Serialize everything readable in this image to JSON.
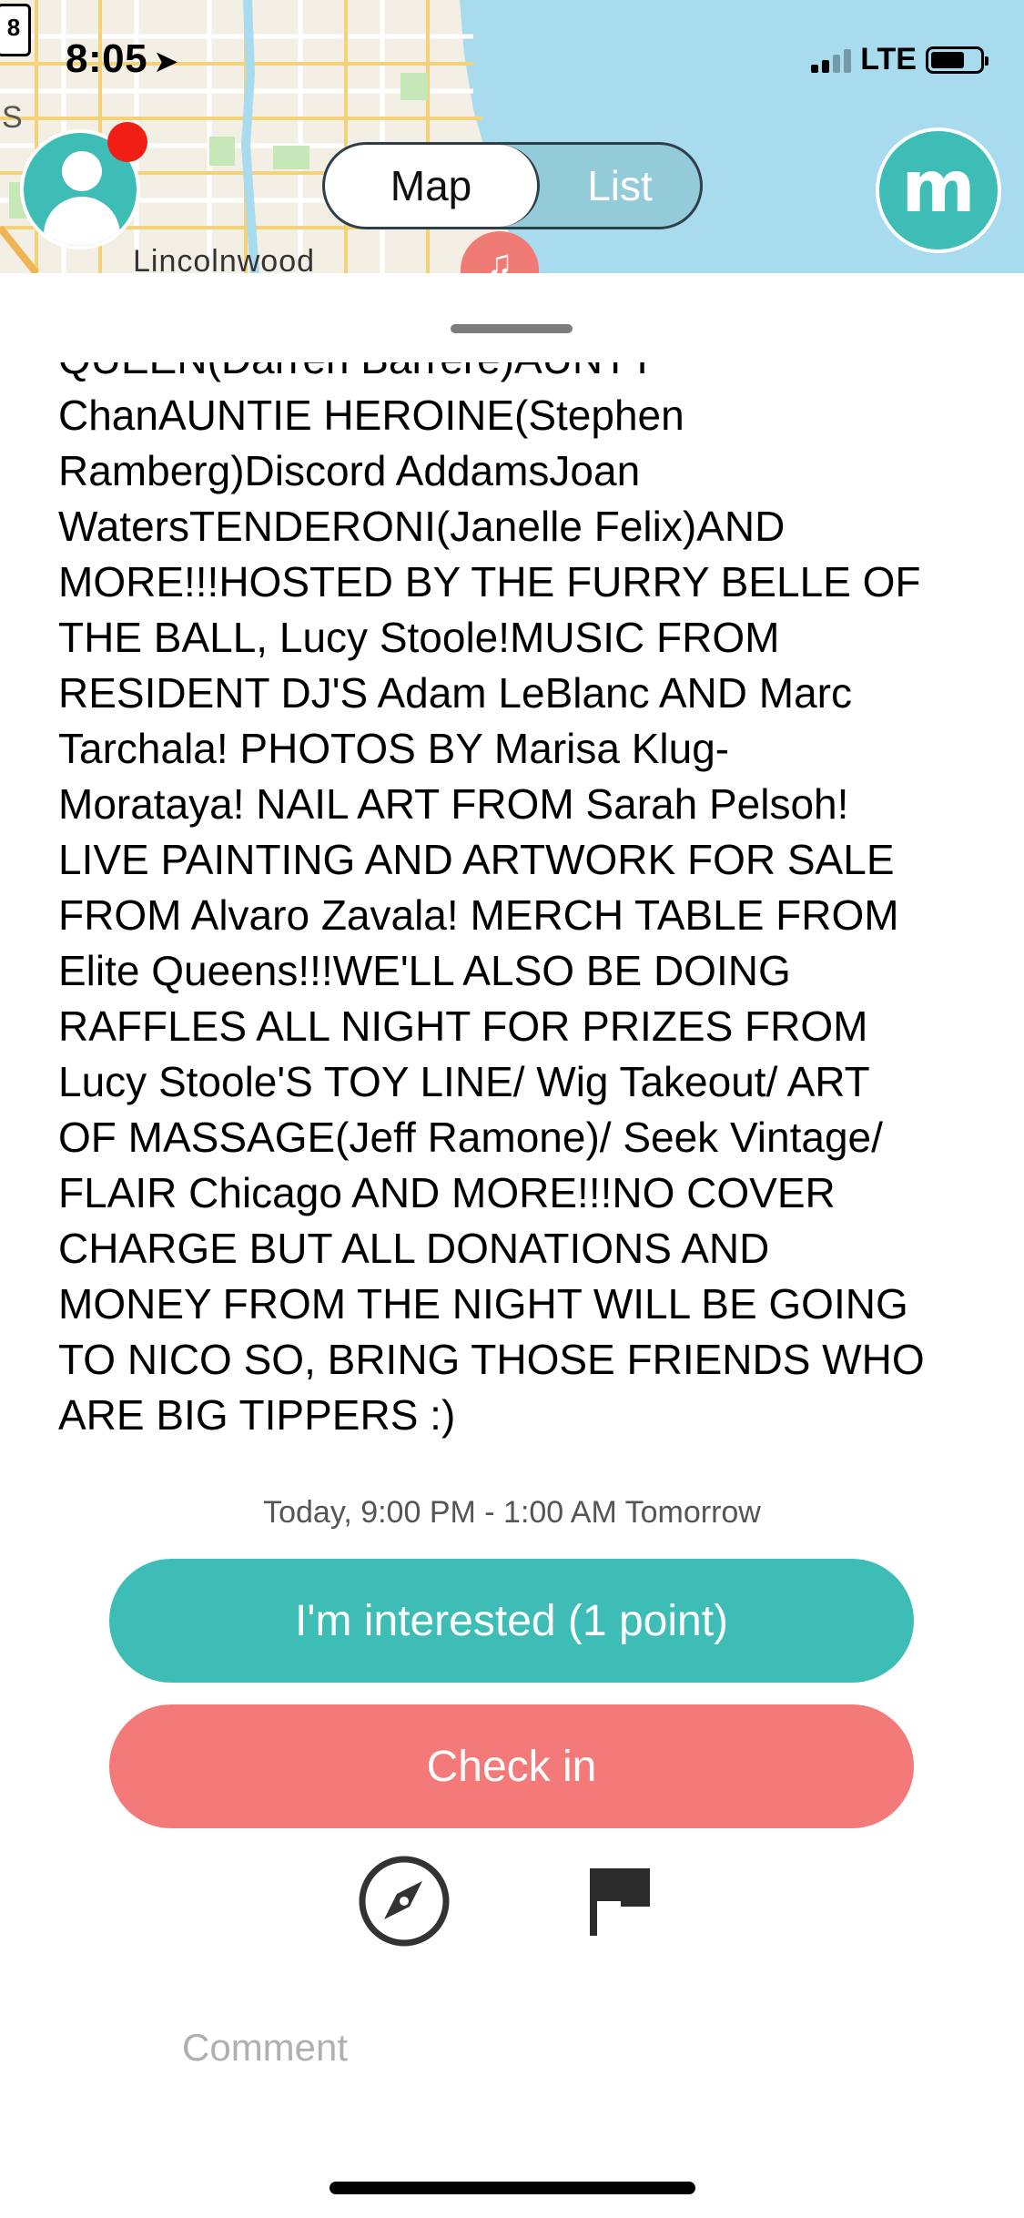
{
  "status_bar": {
    "time": "8:05",
    "location_icon": "location-arrow-icon",
    "carrier": "LTE",
    "road_shield": "8",
    "signal_bars": 4,
    "signal_filled": 2,
    "battery_level": 0.62
  },
  "map": {
    "place_label": "Lincolnwood",
    "edge_label": "S",
    "pin_icon": "music-note-icon",
    "water_color": "#a9dbef",
    "land_color": "#f3efe4"
  },
  "header": {
    "segment": {
      "options": [
        "Map",
        "List"
      ],
      "selected": "Map"
    },
    "avatar_icon": "user-avatar-icon",
    "logo_letter": "m",
    "accent_color": "#3dbdb6",
    "notification_color": "#f01e14"
  },
  "event": {
    "description_partial_top": "QUEEN(Darren Barrere)AUNTY",
    "description": "ChanAUNTIE HEROINE(Stephen\nRamberg)Discord AddamsJoan\nWatersTENDERONI(Janelle Felix)AND\nMORE!!!HOSTED BY THE FURRY BELLE OF\nTHE BALL, Lucy Stoole!MUSIC FROM\nRESIDENT DJ'S Adam LeBlanc AND Marc\nTarchala! PHOTOS BY Marisa Klug-\nMorataya! NAIL ART FROM Sarah Pelsoh!\nLIVE PAINTING AND ARTWORK FOR SALE\nFROM Alvaro Zavala! MERCH TABLE FROM\nElite Queens!!!WE'LL ALSO BE DOING\nRAFFLES ALL NIGHT FOR PRIZES FROM\nLucy Stoole'S TOY LINE/ Wig Takeout/ ART\nOF MASSAGE(Jeff Ramone)/ Seek Vintage/\nFLAIR Chicago AND MORE!!!NO COVER\nCHARGE BUT ALL DONATIONS AND\nMONEY FROM THE NIGHT WILL BE GOING\nTO NICO SO, BRING THOSE FRIENDS WHO\nARE BIG TIPPERS :)",
    "time_range": "Today, 9:00 PM - 1:00 AM Tomorrow"
  },
  "actions": {
    "interested_label": "I'm interested (1 point)",
    "checkin_label": "Check in",
    "interested_color": "#3dbdb6",
    "checkin_color": "#f47a79",
    "directions_icon": "compass-icon",
    "report_icon": "flag-icon"
  },
  "comment": {
    "placeholder": "Comment",
    "value": ""
  }
}
